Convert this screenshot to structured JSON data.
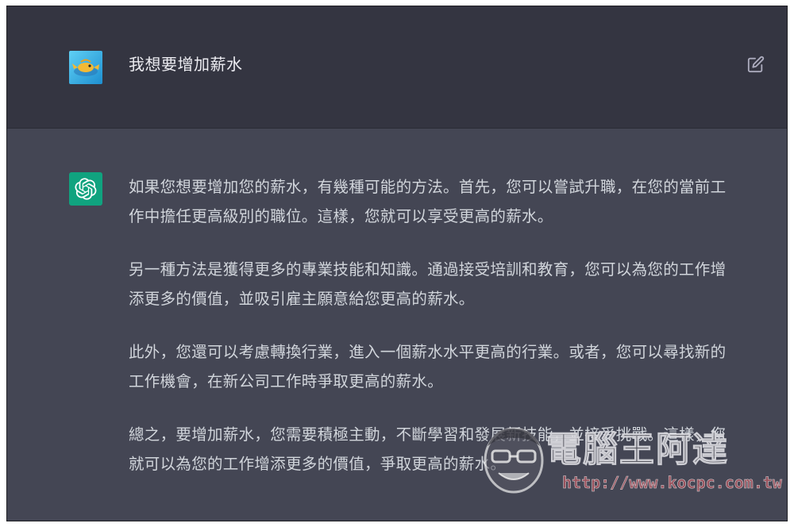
{
  "user_message": {
    "avatar": "user-avatar-image",
    "text": "我想要增加薪水",
    "edit_icon": "edit-icon"
  },
  "assistant_message": {
    "avatar": "chatgpt-logo-icon",
    "paragraphs": [
      "如果您想要增加您的薪水，有幾種可能的方法。首先，您可以嘗試升職，在您的當前工作中擔任更高級別的職位。這樣，您就可以享受更高的薪水。",
      "另一種方法是獲得更多的專業技能和知識。通過接受培訓和教育，您可以為您的工作增添更多的價值，並吸引雇主願意給您更高的薪水。",
      "此外，您還可以考慮轉換行業，進入一個薪水水平更高的行業。或者，您可以尋找新的工作機會，在新公司工作時爭取更高的薪水。",
      "總之，要增加薪水，您需要積極主動，不斷學習和發展新技能，並接受挑戰。這樣，您就可以為您的工作增添更多的價值，爭取更高的薪水。"
    ]
  },
  "watermark": {
    "title": "電腦王阿達",
    "url": "http://www.kocpc.com.tw"
  },
  "colors": {
    "user_bg": "#343541",
    "assistant_bg": "#444654",
    "text": "#d1d5db",
    "chatgpt_green": "#10a37f"
  }
}
